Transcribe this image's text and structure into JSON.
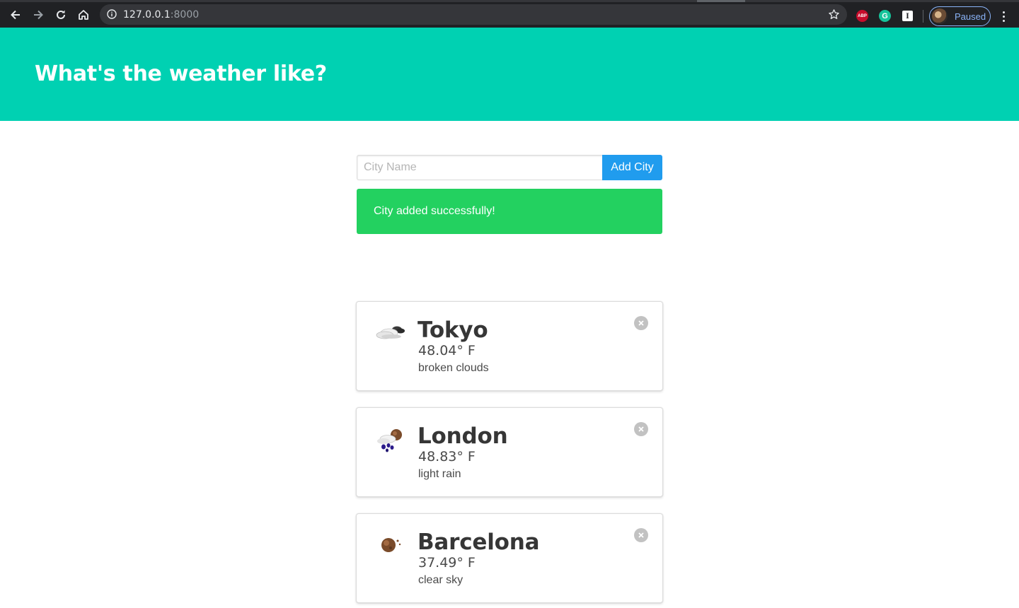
{
  "browser": {
    "url_host": "127.0.0.1",
    "url_port": ":8000",
    "profile_status": "Paused",
    "extensions": [
      "ABP",
      "G",
      "I"
    ]
  },
  "hero": {
    "title": "What's the weather like?"
  },
  "form": {
    "city_placeholder": "City Name",
    "city_value": "",
    "add_button_label": "Add City"
  },
  "notification": {
    "message": "City added successfully!",
    "color": "#23d160"
  },
  "colors": {
    "hero_bg": "#00d1b2",
    "button_bg": "#209cee"
  },
  "cities": [
    {
      "name": "Tokyo",
      "temperature": "48.04° F",
      "description": "broken clouds",
      "icon": "broken-clouds-icon"
    },
    {
      "name": "London",
      "temperature": "48.83° F",
      "description": "light rain",
      "icon": "light-rain-icon"
    },
    {
      "name": "Barcelona",
      "temperature": "37.49° F",
      "description": "clear sky",
      "icon": "clear-sky-night-icon"
    }
  ]
}
